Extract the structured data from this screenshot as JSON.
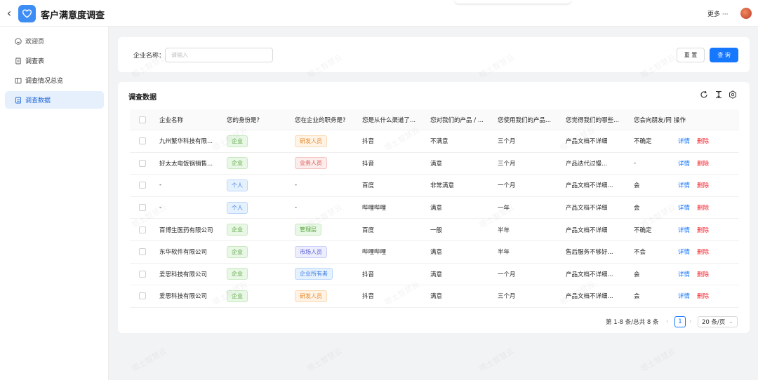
{
  "header": {
    "title": "客户满意度调查",
    "more_label": "更多 ···",
    "back_icon": "chevron-left-icon",
    "logo_icon": "heart-icon",
    "accent_color": "#3d8df5"
  },
  "sidebar": {
    "items": [
      {
        "label": "欢迎页",
        "icon": "smile-icon",
        "active": false
      },
      {
        "label": "调查表",
        "icon": "file-icon",
        "active": false
      },
      {
        "label": "调查情况总览",
        "icon": "dashboard-icon",
        "active": false
      },
      {
        "label": "调查数据",
        "icon": "table-icon",
        "active": true
      }
    ]
  },
  "filter": {
    "label": "企业名称：",
    "placeholder": "请输入",
    "value": "",
    "reset_label": "重 置",
    "query_label": "查 询"
  },
  "table": {
    "title": "调查数据",
    "toolbar_icons": [
      "reload-icon",
      "column-height-icon",
      "settings-icon"
    ],
    "headers": [
      "企业名称",
      "您的身份是?",
      "您在企业的职务是?",
      "您是从什么渠道了...",
      "您对我们的产品 / ...",
      "您使用我们的产品...",
      "您觉得我们的哪些...",
      "您会向朋友/同",
      "操作"
    ],
    "detail_label": "详情",
    "delete_label": "删除",
    "rows": [
      {
        "company": "九州繁华科技有限...",
        "identity": "企业",
        "identity_color": "green",
        "position": "研发人员",
        "position_color": "orange",
        "channel": "抖音",
        "satisfaction": "不满意",
        "duration": "三个月",
        "improve": "产品文档不详细",
        "recommend": "不确定"
      },
      {
        "company": "好太太电饭锅销售...",
        "identity": "企业",
        "identity_color": "green",
        "position": "业务人员",
        "position_color": "red",
        "channel": "抖音",
        "satisfaction": "满意",
        "duration": "三个月",
        "improve": "产品迭代过慢...",
        "recommend": "-"
      },
      {
        "company": "-",
        "identity": "个人",
        "identity_color": "blue",
        "position": "-",
        "position_color": "",
        "channel": "百度",
        "satisfaction": "非常满意",
        "duration": "一个月",
        "improve": "产品文档不详细...",
        "recommend": "会"
      },
      {
        "company": "-",
        "identity": "个人",
        "identity_color": "blue",
        "position": "-",
        "position_color": "",
        "channel": "哔哩哔哩",
        "satisfaction": "满意",
        "duration": "一年",
        "improve": "产品文档不详细",
        "recommend": "会"
      },
      {
        "company": "百博生医药有限公司",
        "identity": "企业",
        "identity_color": "green",
        "position": "管理层",
        "position_color": "green",
        "channel": "百度",
        "satisfaction": "一般",
        "duration": "半年",
        "improve": "产品文档不详细",
        "recommend": "不确定"
      },
      {
        "company": "东华软件有限公司",
        "identity": "企业",
        "identity_color": "green",
        "position": "市场人员",
        "position_color": "indigo",
        "channel": "哔哩哔哩",
        "satisfaction": "满意",
        "duration": "半年",
        "improve": "售后服务不够好...",
        "recommend": "不会"
      },
      {
        "company": "爱思科技有限公司",
        "identity": "企业",
        "identity_color": "green",
        "position": "企业所有者",
        "position_color": "blue",
        "channel": "抖音",
        "satisfaction": "满意",
        "duration": "一个月",
        "improve": "产品文档不详细...",
        "recommend": "会"
      },
      {
        "company": "爱思科技有限公司",
        "identity": "企业",
        "identity_color": "green",
        "position": "研发人员",
        "position_color": "orange",
        "channel": "抖音",
        "satisfaction": "满意",
        "duration": "三个月",
        "improve": "产品文档不详细...",
        "recommend": "会"
      }
    ]
  },
  "pagination": {
    "summary": "第 1-8 条/总共 8 条",
    "current_page": "1",
    "page_size": "20 条/页",
    "prev_icon": "chevron-left-icon",
    "next_icon": "chevron-right-icon"
  },
  "watermark_text": "嗯土智慧云"
}
